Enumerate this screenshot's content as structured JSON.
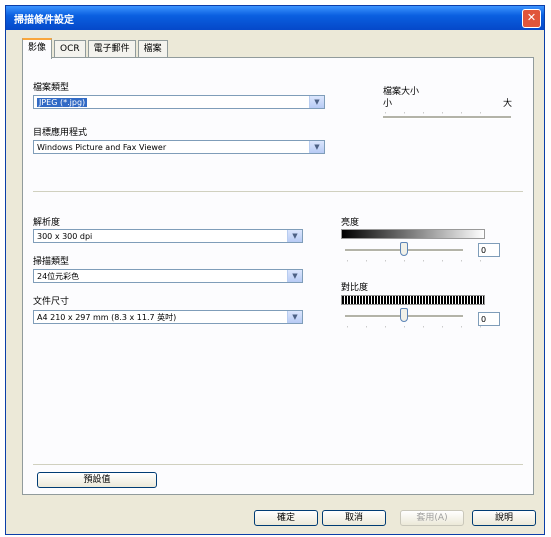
{
  "window": {
    "title": "掃描條件設定"
  },
  "tabs": [
    {
      "label": "影像"
    },
    {
      "label": "OCR"
    },
    {
      "label": "電子郵件"
    },
    {
      "label": "檔案"
    }
  ],
  "image": {
    "file_type_label": "檔案類型",
    "file_type_value": "JPEG (*.jpg)",
    "target_app_label": "目標應用程式",
    "target_app_value": "Windows Picture and Fax Viewer",
    "file_size_label": "檔案大小",
    "file_size_small": "小",
    "file_size_large": "大",
    "resolution_label": "解析度",
    "resolution_value": "300 x 300 dpi",
    "scan_type_label": "掃描類型",
    "scan_type_value": "24位元彩色",
    "doc_size_label": "文件尺寸",
    "doc_size_value": "A4 210 x 297 mm (8.3 x 11.7 英吋)",
    "brightness_label": "亮度",
    "brightness_value": "0",
    "contrast_label": "對比度",
    "contrast_value": "0",
    "default_button": "預設值"
  },
  "footer": {
    "ok": "確定",
    "cancel": "取消",
    "apply": "套用(A)",
    "help": "說明"
  }
}
